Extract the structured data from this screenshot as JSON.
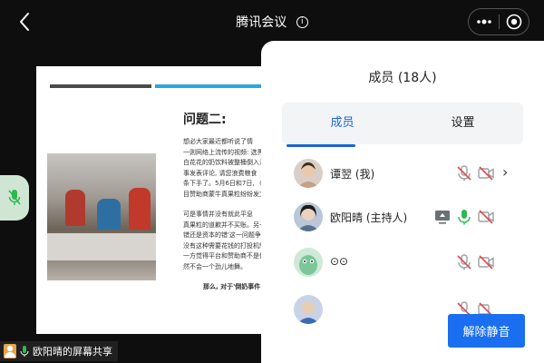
{
  "topbar": {
    "title": "腾讯会议",
    "info_icon_text": "i",
    "back_icon": "chevron-left-icon",
    "more_icon": "more-dots-icon",
    "record_icon": "target-circle-icon"
  },
  "slide": {
    "heading": "问题二:",
    "lines": [
      "想必大家最近都听说了情",
      "一则网络上流传的视频: 选秀",
      "白花花的奶饮料被整桶倒入沙",
      "事发表评论, 请您浪费粮食",
      "条下手了。5月6日和7日, 《",
      "目赞助商蒙牛真果粒纷纷发文"
    ],
    "lines2": [
      "可是事情并没有就此平息",
      "真果粒的道歉并不买账。另一",
      "错还是资本的错'这一问题争论",
      "没有这种需要花钱的打投机制",
      "一方觉得平台和赞助商不是傻",
      "然不会一个劲儿地舞。"
    ],
    "bold_line": "那么, 对于'倒奶事件"
  },
  "share_label": "欧阳晴的屏幕共享",
  "panel": {
    "title": "成员 (18人)",
    "tabs": {
      "members": "成员",
      "settings": "设置"
    },
    "members": [
      {
        "name": "谭翌 (我)",
        "mic": "muted",
        "video": "off",
        "chevron": "›"
      },
      {
        "name": "欧阳晴 (主持人)",
        "mic": "active",
        "video": "off",
        "screen_share": true
      },
      {
        "name": "⊙⊙",
        "mic": "muted",
        "video": "off"
      },
      {
        "name": "",
        "mic": "muted",
        "video": "off"
      }
    ],
    "unmute_label": "解除静音"
  },
  "colors": {
    "accent_blue": "#1a64d6",
    "button_blue": "#1a6ff0",
    "muted_red": "#e04a4a",
    "mic_green": "#2fb84f",
    "slide_bar_blue": "#2aa6e0",
    "mic_pill_bg": "#cfe6d4"
  }
}
